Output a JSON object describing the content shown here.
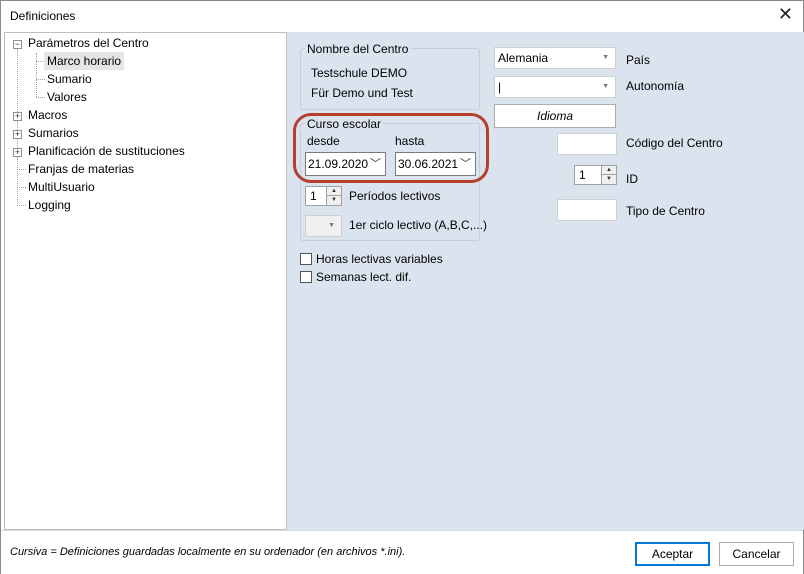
{
  "window": {
    "title": "Definiciones",
    "close_icon": "close-icon"
  },
  "tree": {
    "items": [
      {
        "label": "Parámetros del Centro",
        "expander": "minus"
      },
      {
        "label": "Marco horario"
      },
      {
        "label": "Sumario"
      },
      {
        "label": "Valores"
      },
      {
        "label": "Macros",
        "expander": "plus"
      },
      {
        "label": "Sumarios",
        "expander": "plus"
      },
      {
        "label": "Planificación de sustituciones",
        "expander": "plus"
      },
      {
        "label": "Franjas de materias"
      },
      {
        "label": "MultiUsuario"
      },
      {
        "label": "Logging"
      }
    ]
  },
  "school": {
    "group_label": "Nombre del Centro",
    "name_line1": "Testschule  DEMO",
    "name_line2": "Für Demo und Test"
  },
  "school_year": {
    "group_label": "Curso escolar",
    "from_label": "desde",
    "to_label": "hasta",
    "from_value": "21.09.2020",
    "to_value": "30.06.2021"
  },
  "periods": {
    "value": "1",
    "label": "Períodos lectivos"
  },
  "first_cycle": {
    "label": "1er ciclo lectivo (A,B,C,...)"
  },
  "checkboxes": {
    "variable_hours": "Horas lectivas variables",
    "diff_weeks": "Semanas lect. dif."
  },
  "right": {
    "country_value": "Alemania",
    "country_label": "País",
    "region_value": "|",
    "region_label": "Autonomía",
    "language_button": "Idioma",
    "school_code_label": "Código del Centro",
    "id_value": "1",
    "id_label": "ID",
    "school_type_label": "Tipo de Centro"
  },
  "footer": {
    "note": "Cursiva = Definiciones guardadas localmente en su ordenador (en archivos *.ini).",
    "accept": "Aceptar",
    "cancel": "Cancelar"
  },
  "colors": {
    "panel_bg": "#dbe4ee",
    "highlight": "#b5402e",
    "accent": "#0078d7"
  }
}
